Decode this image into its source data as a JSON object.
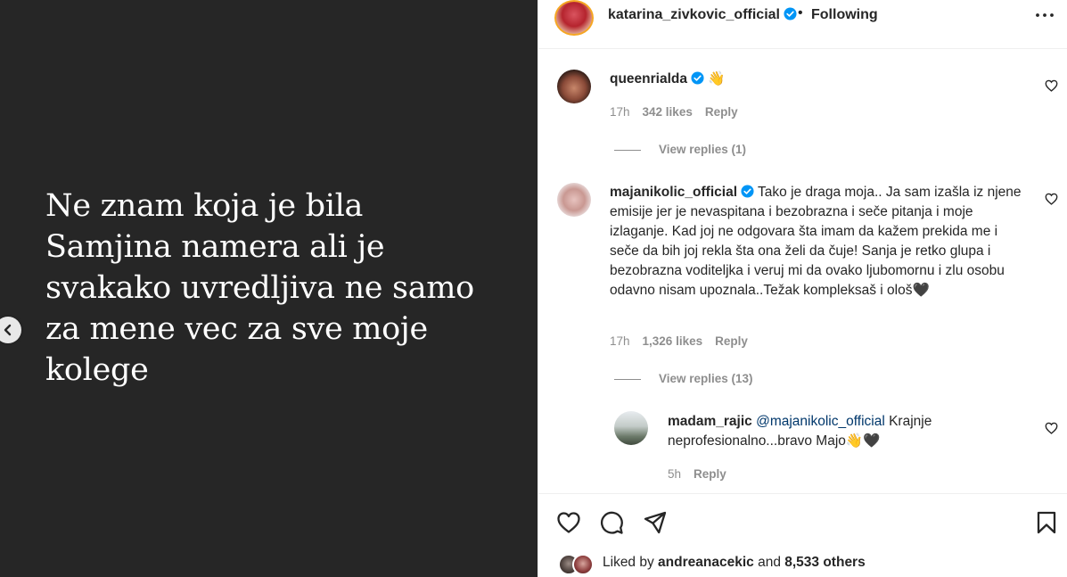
{
  "post": {
    "image_text": "Ne znam koja je bila\nSamjina namera ali je\nsvakako uvredljiva ne samo\nza mene vec za sve moje\nkolege"
  },
  "header": {
    "username": "katarina_zivkovic_official",
    "dot": "•",
    "follow_status": "Following"
  },
  "comments": [
    {
      "username": "queenrialda",
      "text": "👋",
      "time": "17h",
      "likes": "342 likes",
      "reply": "Reply",
      "view_replies": "View replies (1)"
    },
    {
      "username": "majanikolic_official",
      "text": "Tako je draga moja.. Ja sam izašla iz njene emisije jer je nevaspitana i bezobrazna i seče pitanja i moje izlaganje. Kad joj ne odgovara šta imam da kažem prekida me i seče da bih joj rekla šta ona želi da čuje! Sanja je retko glupa i bezobrazna voditeljka i veruj mi da ovako ljubomornu i zlu osobu odavno nisam upoznala..Težak kompleksaš i ološ🖤",
      "time": "17h",
      "likes": "1,326 likes",
      "reply": "Reply",
      "view_replies": "View replies (13)"
    }
  ],
  "reply": {
    "username": "madam_rajic",
    "mention": "@majanikolic_official",
    "text": " Krajnje neprofesionalno...bravo Majo👋🖤",
    "time": "5h",
    "reply": "Reply"
  },
  "likes_summary": {
    "prefix": "Liked by ",
    "user": "andreanacekic",
    "middle": " and ",
    "count": "8,533 others"
  },
  "colors": {
    "post_bg": "#262626",
    "text_primary": "#262626",
    "text_secondary": "#8e8e8e",
    "verified": "#0095f6",
    "mention": "#00376b"
  },
  "icons": {
    "prev": "chevron-left-icon",
    "more": "more-horizontal-icon",
    "like": "heart-icon",
    "comment": "comment-icon",
    "share": "send-icon",
    "save": "bookmark-icon"
  }
}
